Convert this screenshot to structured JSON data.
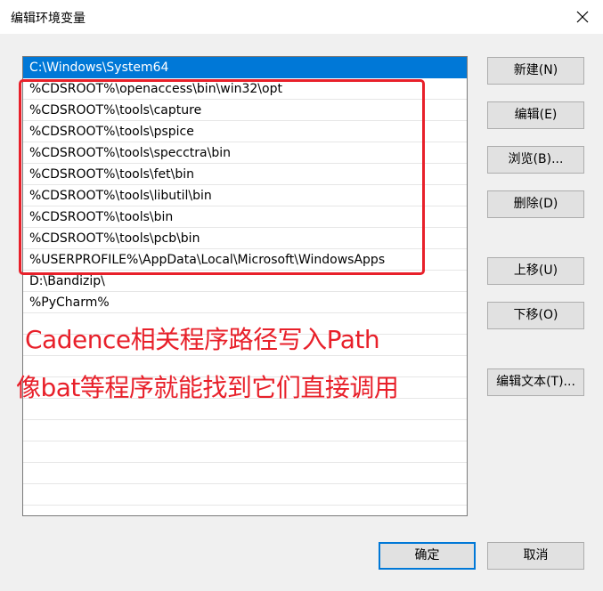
{
  "window": {
    "title": "编辑环境变量"
  },
  "list": {
    "items": [
      "C:\\Windows\\System64",
      "%CDSROOT%\\openaccess\\bin\\win32\\opt",
      "%CDSROOT%\\tools\\capture",
      "%CDSROOT%\\tools\\pspice",
      "%CDSROOT%\\tools\\specctra\\bin",
      "%CDSROOT%\\tools\\fet\\bin",
      "%CDSROOT%\\tools\\libutil\\bin",
      "%CDSROOT%\\tools\\bin",
      "%CDSROOT%\\tools\\pcb\\bin",
      "%USERPROFILE%\\AppData\\Local\\Microsoft\\WindowsApps",
      "D:\\Bandizip\\",
      "%PyCharm%",
      "",
      "",
      "",
      "",
      "",
      "",
      "",
      "",
      ""
    ],
    "selected_index": 0
  },
  "buttons": {
    "new": "新建(N)",
    "edit": "编辑(E)",
    "browse": "浏览(B)...",
    "delete": "删除(D)",
    "move_up": "上移(U)",
    "move_down": "下移(O)",
    "edit_text": "编辑文本(T)...",
    "ok": "确定",
    "cancel": "取消"
  },
  "annotation": {
    "line1": "Cadence相关程序路径写入Path",
    "line2": "像bat等程序就能找到它们直接调用",
    "color": "#e8202a"
  },
  "colors": {
    "selection": "#0078d7",
    "dialog_background": "#f0f0f0",
    "button_background": "#e1e1e1"
  }
}
